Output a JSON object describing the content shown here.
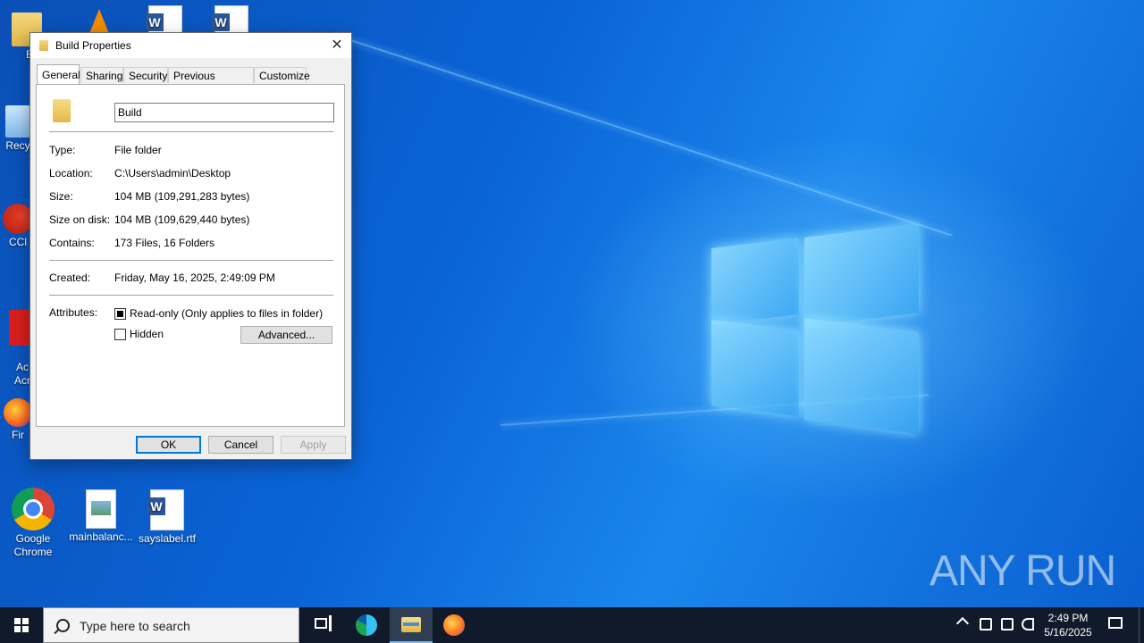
{
  "desktop": {
    "icons": [
      {
        "label": "Br",
        "kind": "folder"
      },
      {
        "label": "",
        "kind": "vlc"
      },
      {
        "label": "",
        "kind": "word"
      },
      {
        "label": "",
        "kind": "word"
      },
      {
        "label": "Recy",
        "kind": "recycle"
      },
      {
        "label": "CCl",
        "kind": "ccleaner"
      },
      {
        "label": "Ac\nAcr",
        "kind": "acrobat"
      },
      {
        "label": "Fir",
        "kind": "firefox"
      },
      {
        "label": "Google Chrome",
        "kind": "chrome"
      },
      {
        "label": "mainbalanc...",
        "kind": "image-file"
      },
      {
        "label": "sayslabel.rtf",
        "kind": "word"
      }
    ],
    "watermark": "ANY RUN"
  },
  "dialog": {
    "title": "Build Properties",
    "close_glyph": "✕",
    "tabs": [
      "General",
      "Sharing",
      "Security",
      "Previous Versions",
      "Customize"
    ],
    "active_tab": "General",
    "name_value": "Build",
    "fields": {
      "type_label": "Type:",
      "type_value": "File folder",
      "location_label": "Location:",
      "location_value": "C:\\Users\\admin\\Desktop",
      "size_label": "Size:",
      "size_value": "104 MB (109,291,283 bytes)",
      "size_on_disk_label": "Size on disk:",
      "size_on_disk_value": "104 MB (109,629,440 bytes)",
      "contains_label": "Contains:",
      "contains_value": "173 Files, 16 Folders",
      "created_label": "Created:",
      "created_value": "Friday, May 16, 2025, 2:49:09 PM",
      "attributes_label": "Attributes:"
    },
    "attributes": {
      "readonly_label": "Read-only (Only applies to files in folder)",
      "readonly_state": "indeterminate",
      "hidden_label": "Hidden",
      "hidden_state": "unchecked",
      "advanced_label": "Advanced..."
    },
    "buttons": {
      "ok": "OK",
      "cancel": "Cancel",
      "apply": "Apply"
    }
  },
  "taskbar": {
    "search_placeholder": "Type here to search",
    "apps": [
      "task-view",
      "edge",
      "file-explorer",
      "firefox"
    ],
    "active_app": "file-explorer",
    "clock_time": "2:49 PM",
    "clock_date": "5/16/2025"
  }
}
